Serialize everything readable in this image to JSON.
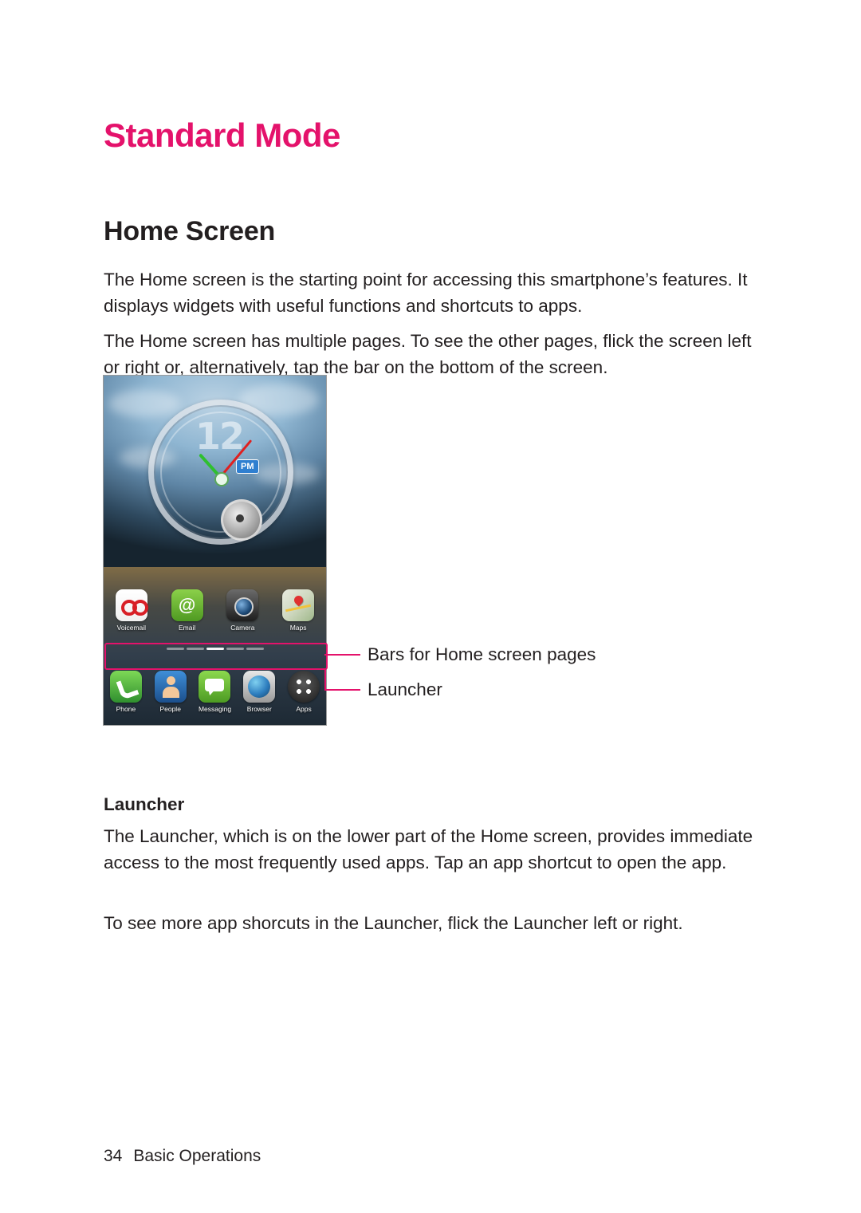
{
  "document": {
    "title": "Standard Mode",
    "section_heading": "Home Screen",
    "paragraphs": {
      "p1": "The Home screen is the starting point for accessing this smartphone’s features. It displays widgets with useful functions and shortcuts to apps.",
      "p2": "The Home screen has multiple pages. To see the other pages, flick the screen left or right or, alternatively, tap the bar on the bottom of the screen.",
      "p3": "The Launcher, which is on the lower part of the Home screen, provides immediate access to the most frequently used apps. Tap an app shortcut to open the app.",
      "p4": "To see more app shorcuts in the Launcher, flick the Launcher left or right."
    },
    "subheading": "Launcher",
    "footer": {
      "page_number": "34",
      "chapter": "Basic Operations"
    },
    "accent_color": "#e4126b",
    "text_color": "#231f20"
  },
  "annotations": [
    {
      "label": "Bars for Home screen pages"
    },
    {
      "label": "Launcher"
    }
  ],
  "screenshot": {
    "clock_widget": {
      "hour_marker": "12",
      "meridiem_badge": "PM"
    },
    "app_row": [
      {
        "label": "Voicemail",
        "icon": "voicemail-icon"
      },
      {
        "label": "Email",
        "icon": "email-icon"
      },
      {
        "label": "Camera",
        "icon": "camera-icon"
      },
      {
        "label": "Maps",
        "icon": "maps-icon"
      }
    ],
    "launcher_row": [
      {
        "label": "Phone",
        "icon": "phone-icon"
      },
      {
        "label": "People",
        "icon": "people-icon"
      },
      {
        "label": "Messaging",
        "icon": "messaging-icon"
      },
      {
        "label": "Browser",
        "icon": "browser-icon"
      },
      {
        "label": "Apps",
        "icon": "apps-grid-icon"
      }
    ],
    "page_indicator": {
      "pages": 5,
      "active_index": 2
    }
  }
}
